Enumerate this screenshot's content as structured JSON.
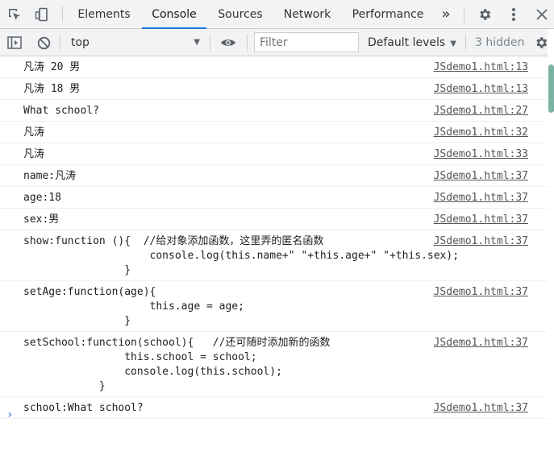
{
  "tabs": {
    "items": [
      {
        "label": "Elements"
      },
      {
        "label": "Console"
      },
      {
        "label": "Sources"
      },
      {
        "label": "Network"
      },
      {
        "label": "Performance"
      }
    ],
    "more": "»"
  },
  "toolbar": {
    "context": "top",
    "filter_placeholder": "Filter",
    "levels": "Default levels",
    "hidden": "3 hidden"
  },
  "icons": {
    "inspect": "inspect-element-icon",
    "device": "device-toolbar-icon",
    "settings": "gear-icon",
    "menu": "kebab-menu-icon",
    "close": "close-icon",
    "sidebar": "sidebar-toggle-icon",
    "clear": "clear-console-icon",
    "eye": "live-expression-icon"
  },
  "colors": {
    "accent": "#1a73e8",
    "link": "#545454"
  },
  "console": {
    "messages": [
      {
        "text": "凡涛 20 男",
        "source": "JSdemo1.html:13"
      },
      {
        "text": "凡涛 18 男",
        "source": "JSdemo1.html:13"
      },
      {
        "text": "What school?",
        "source": "JSdemo1.html:27"
      },
      {
        "text": "凡涛",
        "source": "JSdemo1.html:32"
      },
      {
        "text": "凡涛",
        "source": "JSdemo1.html:33"
      },
      {
        "text": "name:凡涛",
        "source": "JSdemo1.html:37"
      },
      {
        "text": "age:18",
        "source": "JSdemo1.html:37"
      },
      {
        "text": "sex:男",
        "source": "JSdemo1.html:37"
      },
      {
        "text": "show:function (){  //给对象添加函数，这里弄的匿名函数\n                    console.log(this.name+\" \"+this.age+\" \"+this.sex);\n                }",
        "source": "JSdemo1.html:37"
      },
      {
        "text": "setAge:function(age){\n                    this.age = age;\n                }",
        "source": "JSdemo1.html:37"
      },
      {
        "text": "setSchool:function(school){   //还可随时添加新的函数\n                this.school = school;\n                console.log(this.school);\n            }",
        "source": "JSdemo1.html:37"
      },
      {
        "text": "school:What school?",
        "source": "JSdemo1.html:37"
      }
    ],
    "prompt": "›"
  }
}
